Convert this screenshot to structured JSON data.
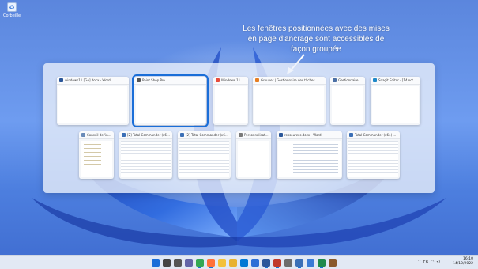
{
  "desktop": {
    "icon_label": "Corbeille",
    "icon_name": "recycle-bin-icon"
  },
  "annotation": {
    "text": "Les fenêtres positionnées avec des mises en page d'ancrage sont accessibles de façon groupée"
  },
  "snap_groups": {
    "row1": [
      {
        "title": "windows11 [GA].docx - Word",
        "icon": "word-icon",
        "icon_color": "#2b579a",
        "pattern": "doc"
      },
      {
        "title": "Paint Shop Pro",
        "icon": "paint-shop-pro-icon",
        "icon_color": "#555555",
        "pattern": "grey",
        "focused": true
      },
      {
        "title": "Windows 11 22...",
        "icon": "browser-icon",
        "icon_color": "#e74c3c",
        "pattern": "web"
      },
      {
        "title": "Grouper | Gestionnaire des tâches",
        "icon": "browser-icon",
        "icon_color": "#e67e22",
        "pattern": "web"
      },
      {
        "title": "Gestionnaire...",
        "icon": "task-manager-icon",
        "icon_color": "#4a6fa5",
        "pattern": "explorer"
      },
      {
        "title": "Snagit Editor - [14 oct. 202...",
        "icon": "snagit-icon",
        "icon_color": "#1e88c8",
        "pattern": "snag"
      }
    ],
    "row2": [
      {
        "title": "Conseil del'in...",
        "icon": "notepad-icon",
        "icon_color": "#6a8bb8",
        "pattern": "connect"
      },
      {
        "title": "[2] Total Commander (x64) 1...",
        "icon": "total-commander-icon",
        "icon_color": "#3b6fb6",
        "pattern": "cmd"
      },
      {
        "title": "[2] Total Commander (x64) 1...",
        "icon": "total-commander-icon",
        "icon_color": "#3b6fb6",
        "pattern": "cmd"
      },
      {
        "title": "Personnalisat...",
        "icon": "settings-icon",
        "icon_color": "#7a7a7a",
        "pattern": "settings"
      },
      {
        "title": "ressources.docx - Word",
        "icon": "word-icon",
        "icon_color": "#2b579a",
        "pattern": "word"
      },
      {
        "title": "Total Commander (x64) 10.0...",
        "icon": "total-commander-icon",
        "icon_color": "#3b6fb6",
        "pattern": "cmd"
      }
    ]
  },
  "taskbar": {
    "apps": [
      {
        "name": "start-icon",
        "color": "#1a6ed8"
      },
      {
        "name": "search-icon",
        "color": "#444444"
      },
      {
        "name": "task-view-icon",
        "color": "#555555"
      },
      {
        "name": "chat-icon",
        "color": "#6264a7"
      },
      {
        "name": "chrome-icon",
        "color": "#34a853",
        "active": true
      },
      {
        "name": "firefox-icon",
        "color": "#ff7139",
        "active": true
      },
      {
        "name": "explorer-icon",
        "color": "#f3c13a"
      },
      {
        "name": "explorer-icon",
        "color": "#e8b230"
      },
      {
        "name": "mail-icon",
        "color": "#0078d4"
      },
      {
        "name": "store-icon",
        "color": "#2b6fd6"
      },
      {
        "name": "word-icon",
        "color": "#2b579a",
        "active": true
      },
      {
        "name": "snagit-icon",
        "color": "#c0392b",
        "active": true
      },
      {
        "name": "settings-icon",
        "color": "#6c6c6c"
      },
      {
        "name": "total-commander-icon",
        "color": "#3b6fb6",
        "active": true
      },
      {
        "name": "notepad-icon",
        "color": "#3a7bd5"
      },
      {
        "name": "paint-shop-pro-icon",
        "color": "#1e8a4c",
        "active": true
      },
      {
        "name": "app-icon",
        "color": "#8a5a2b"
      }
    ],
    "tray": {
      "chevron": "^",
      "lang": "FR",
      "network": "wifi-icon",
      "volume": "volume-icon"
    },
    "clock": {
      "time": "16:10",
      "date": "14/10/2022"
    }
  }
}
